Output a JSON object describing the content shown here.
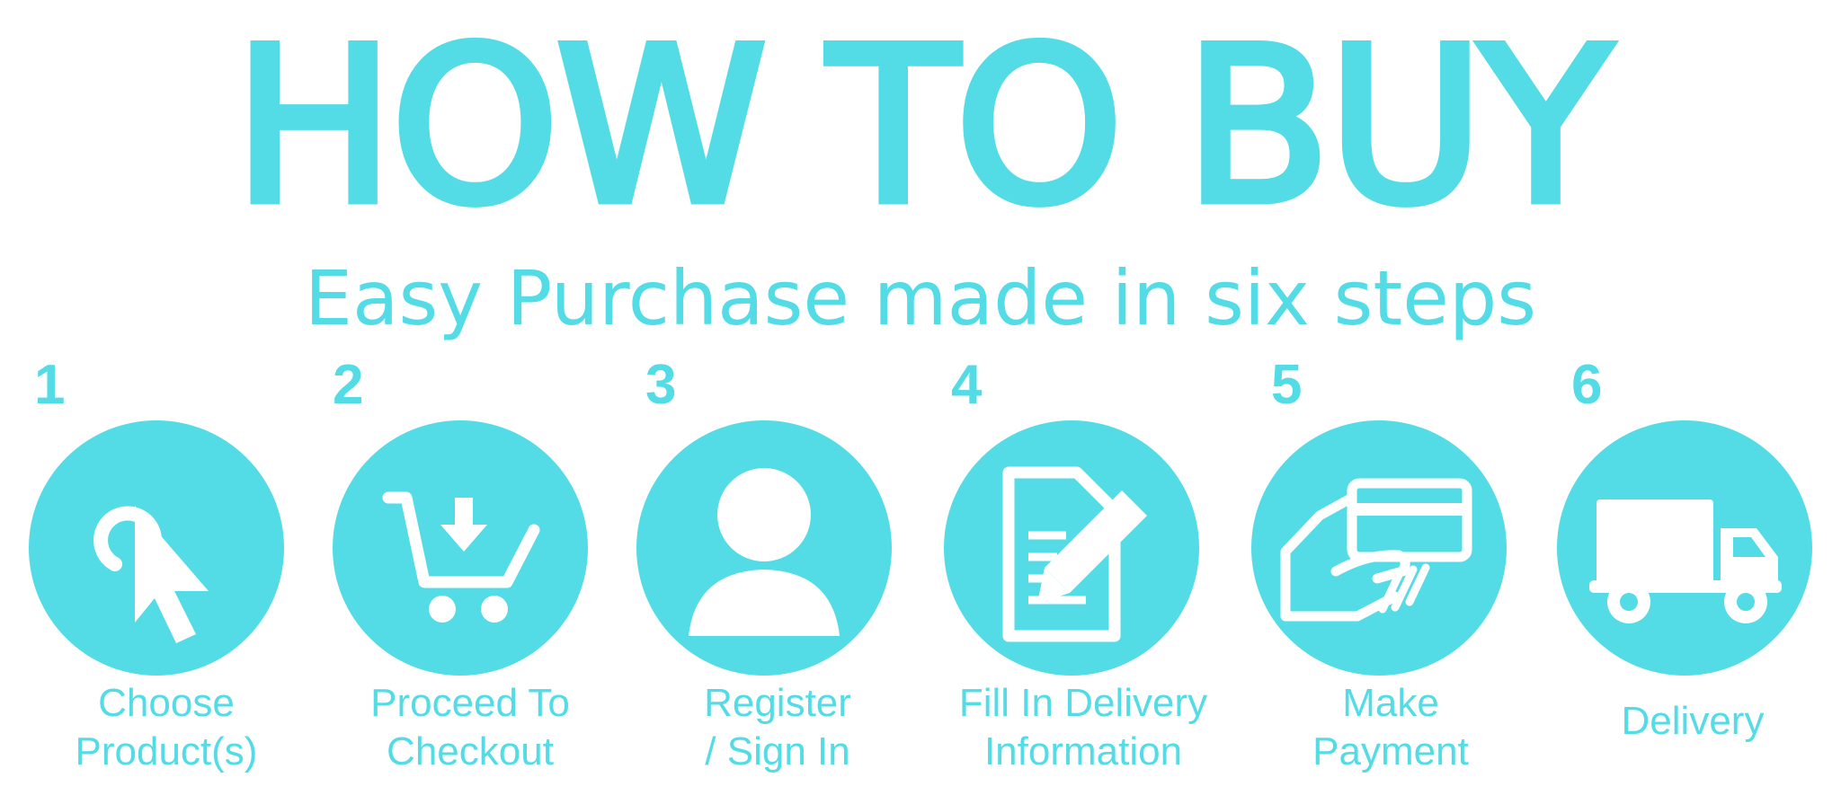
{
  "title": "HOW TO BUY",
  "subtitle": "Easy Purchase made in six steps",
  "colors": {
    "accent": "#53dce6",
    "background": "#ffffff"
  },
  "steps": [
    {
      "number": "1",
      "icon": "cursor-click-icon",
      "label_lines": [
        "Choose",
        "Product(s)"
      ]
    },
    {
      "number": "2",
      "icon": "cart-download-icon",
      "label_lines": [
        "Proceed To",
        "Checkout"
      ]
    },
    {
      "number": "3",
      "icon": "user-icon",
      "label_lines": [
        "Register",
        "/ Sign In"
      ]
    },
    {
      "number": "4",
      "icon": "form-edit-icon",
      "label_lines": [
        "Fill In Delivery",
        "Information"
      ]
    },
    {
      "number": "5",
      "icon": "card-payment-icon",
      "label_lines": [
        "Make",
        "Payment"
      ]
    },
    {
      "number": "6",
      "icon": "delivery-truck-icon",
      "label_lines": [
        "Delivery"
      ]
    }
  ]
}
